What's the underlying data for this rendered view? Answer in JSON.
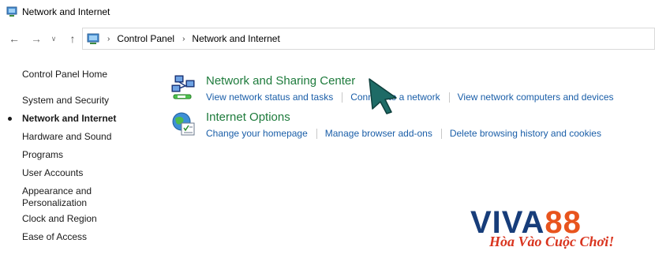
{
  "window": {
    "title": "Network and Internet"
  },
  "navigation": {
    "back_icon": "←",
    "forward_icon": "→",
    "recent_icon": "∨",
    "up_icon": "↑",
    "breadcrumb": [
      {
        "label": "Control Panel"
      },
      {
        "label": "Network and Internet"
      }
    ],
    "separator": "›"
  },
  "sidebar": {
    "home_label": "Control Panel Home",
    "items": [
      {
        "label": "System and Security",
        "current": false
      },
      {
        "label": "Network and Internet",
        "current": true
      },
      {
        "label": "Hardware and Sound",
        "current": false
      },
      {
        "label": "Programs",
        "current": false
      },
      {
        "label": "User Accounts",
        "current": false
      },
      {
        "label": "Appearance and",
        "label2": "Personalization",
        "current": false
      },
      {
        "label": "Clock and Region",
        "current": false
      },
      {
        "label": "Ease of Access",
        "current": false
      }
    ]
  },
  "categories": [
    {
      "title": "Network and Sharing Center",
      "icon": "network-sharing-icon",
      "links": [
        "View network status and tasks",
        "Connect to a network",
        "View network computers and devices"
      ]
    },
    {
      "title": "Internet Options",
      "icon": "internet-options-icon",
      "links": [
        "Change your homepage",
        "Manage browser add-ons",
        "Delete browsing history and cookies"
      ]
    }
  ],
  "watermark": {
    "brand_part1": "VIVA",
    "brand_part2": "88",
    "slogan": "Hòa Vào Cuộc Chơi!"
  },
  "colors": {
    "category_title": "#1e7b3c",
    "link": "#1a5ea8",
    "cursor": "#1e6b66",
    "brand_blue": "#173d7a",
    "brand_orange": "#e8541d"
  }
}
